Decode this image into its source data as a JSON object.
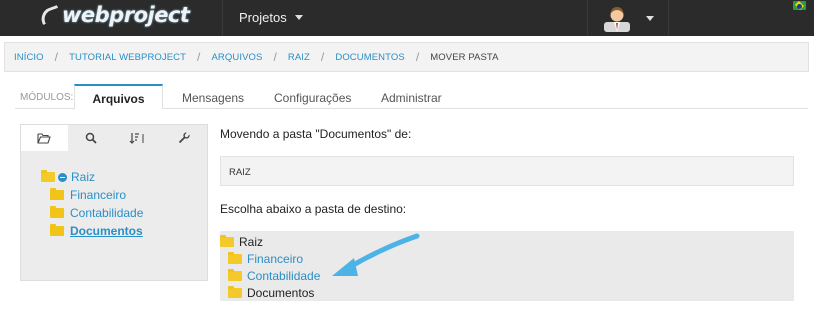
{
  "topbar": {
    "logo_text": "webproject",
    "projects_label": "Projetos"
  },
  "breadcrumb": [
    {
      "label": "INÍCIO"
    },
    {
      "label": "TUTORIAL WEBPROJECT"
    },
    {
      "label": "ARQUIVOS"
    },
    {
      "label": "RAIZ"
    },
    {
      "label": "DOCUMENTOS"
    },
    {
      "label": "MOVER PASTA"
    }
  ],
  "modules": {
    "label": "MÓDULOS:",
    "tabs": [
      {
        "label": "Arquivos",
        "active": true
      },
      {
        "label": "Mensagens"
      },
      {
        "label": "Configurações"
      },
      {
        "label": "Administrar"
      }
    ]
  },
  "left_panel": {
    "icons": [
      "folder-open-icon",
      "search-icon",
      "sort-icon",
      "wrench-icon"
    ],
    "tree": {
      "root": "Raiz",
      "children": [
        "Financeiro",
        "Contabilidade",
        "Documentos"
      ]
    }
  },
  "main": {
    "moving_text": "Movendo a pasta \"Documentos\" de:",
    "current_path": "RAIZ",
    "choose_text": "Escolha abaixo a pasta de destino:",
    "destination": {
      "root": "Raiz",
      "children": [
        "Financeiro",
        "Contabilidade",
        "Documentos"
      ]
    }
  },
  "colors": {
    "accent": "#2a8fc6",
    "folder": "#f0c419",
    "topbar": "#2b2b2b",
    "arrow": "#4db3e6"
  }
}
